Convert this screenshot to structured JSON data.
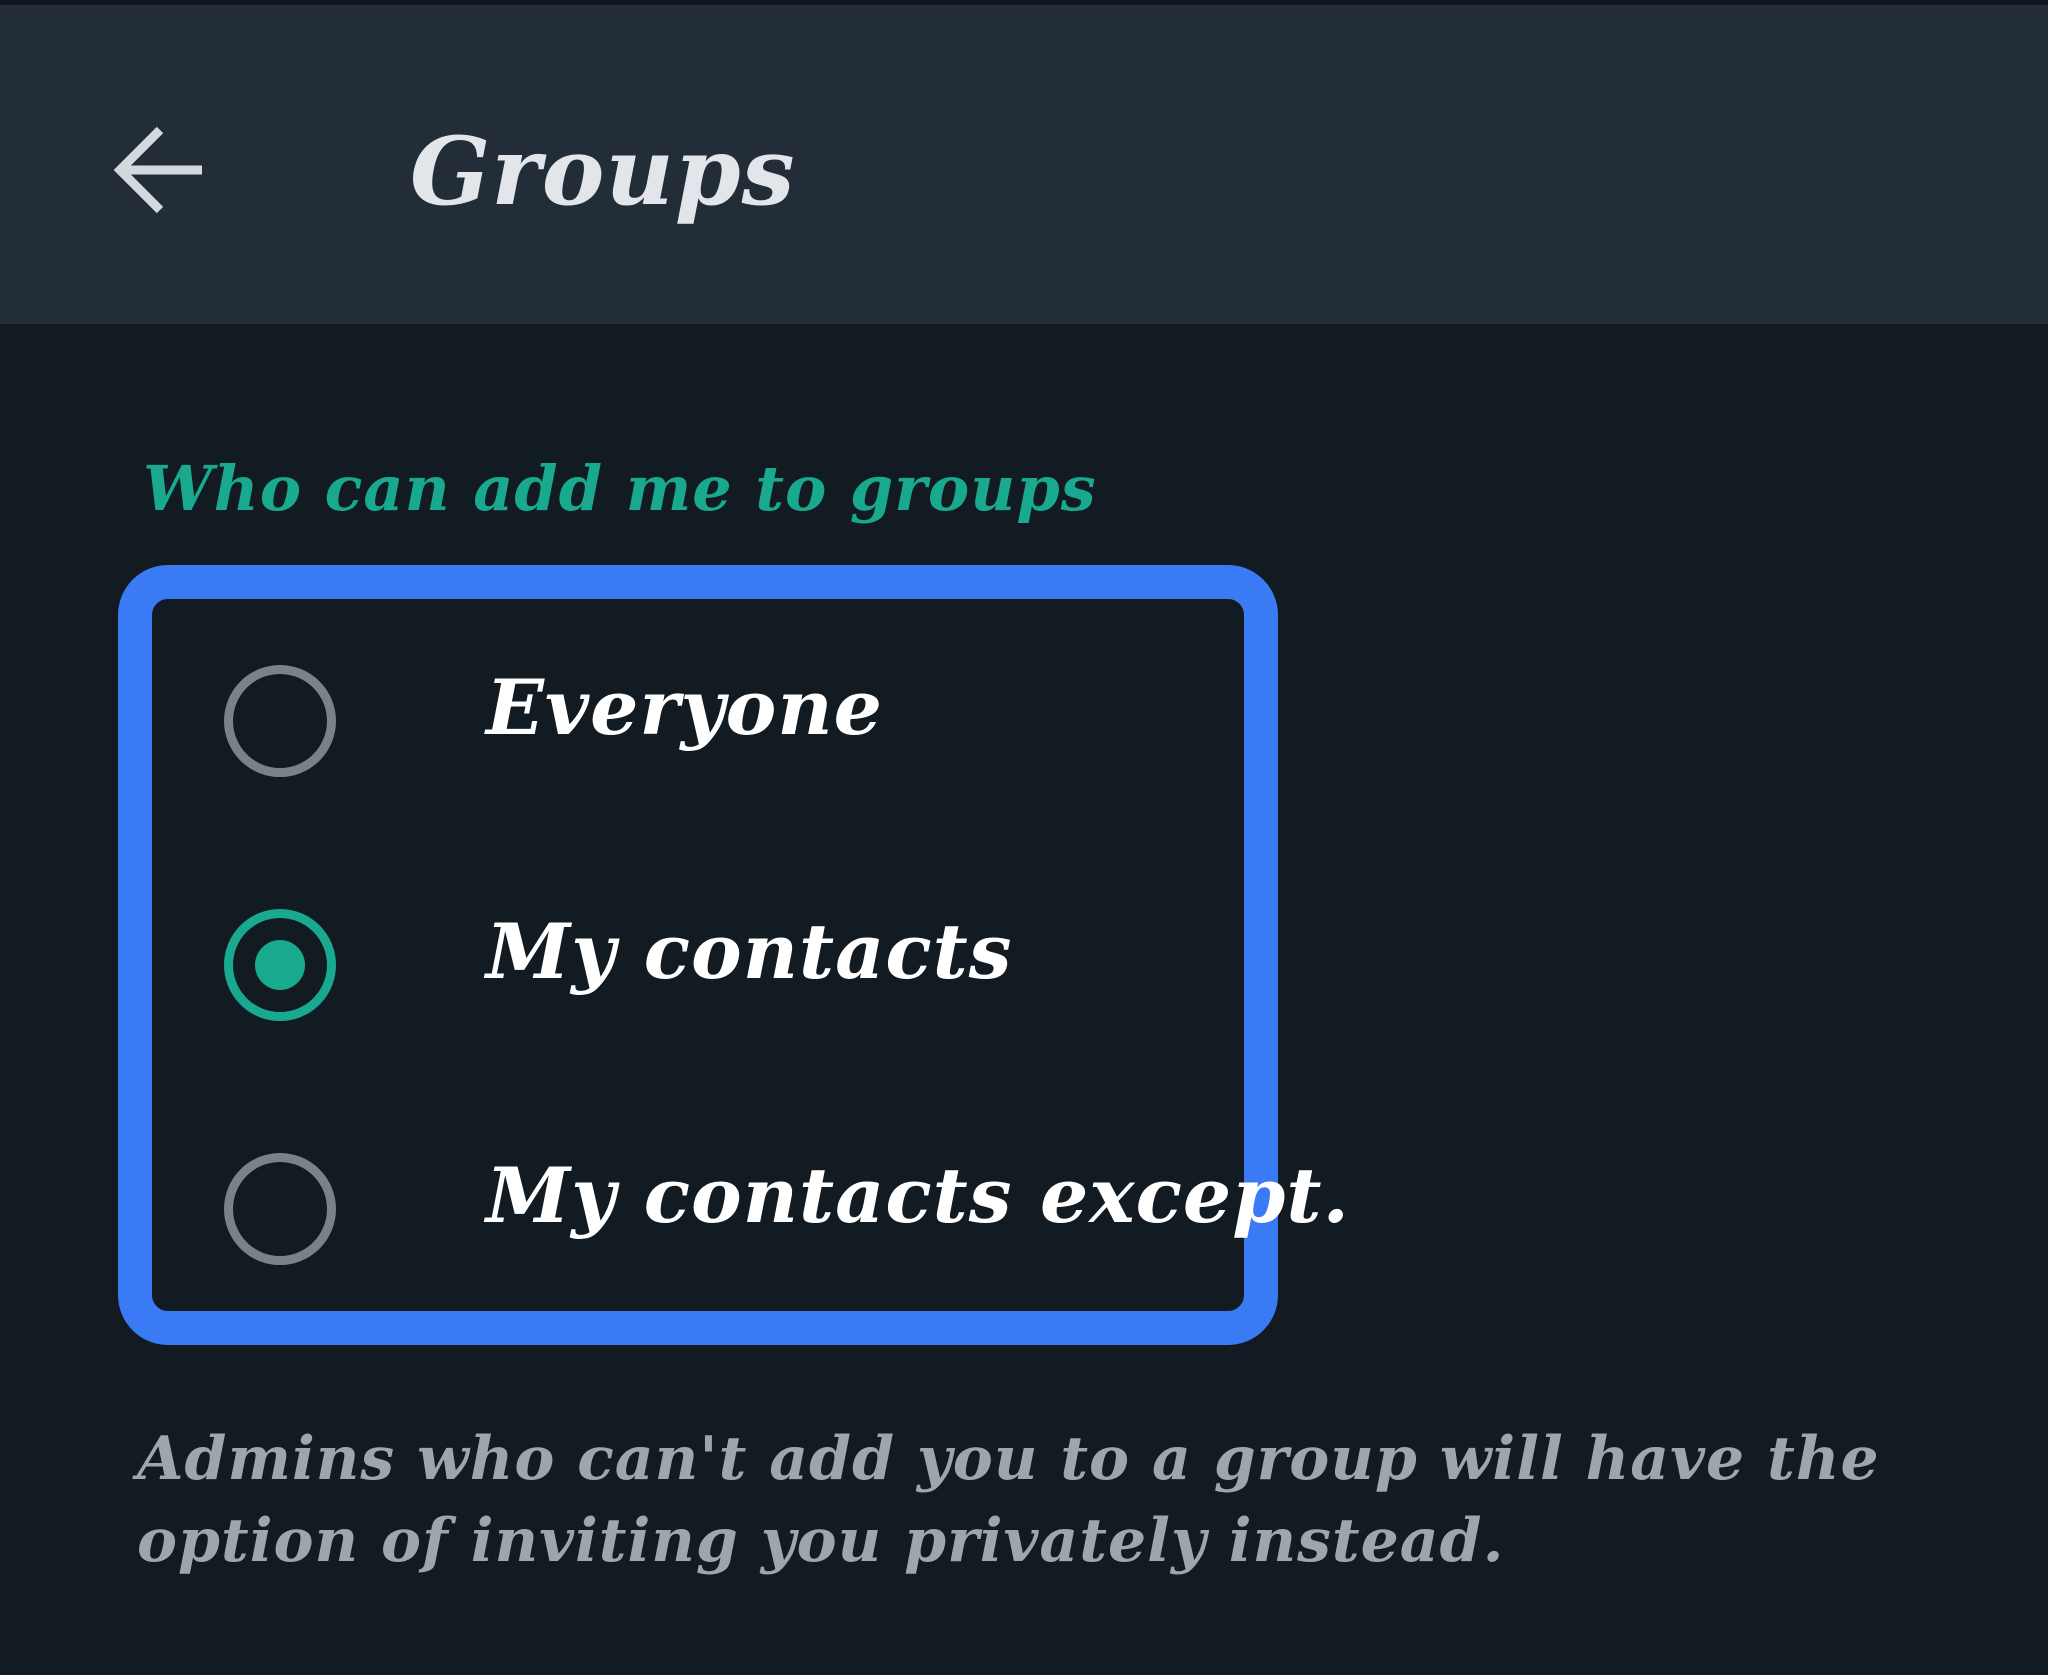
{
  "header": {
    "back_icon": "arrow-left-icon",
    "title": "Groups"
  },
  "section": {
    "label": "Who can add me to groups"
  },
  "options": [
    {
      "label": "Everyone",
      "selected": false
    },
    {
      "label": "My contacts",
      "selected": true
    },
    {
      "label": "My contacts except.",
      "selected": false
    }
  ],
  "footnote": "Admins who can't add you to a group will have the option of inviting you privately instead.",
  "colors": {
    "background": "#121b22",
    "appbar": "#232d38",
    "accent": "#19a98e",
    "highlight_border": "#3a7af5",
    "radio_unchecked": "#7b8286"
  }
}
